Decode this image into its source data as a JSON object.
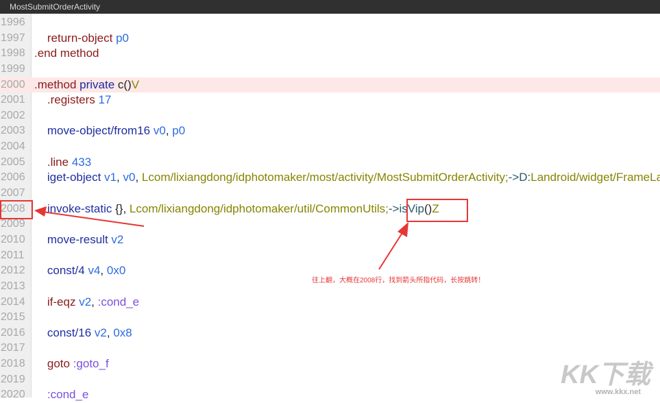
{
  "window": {
    "title": "MostSubmitOrderActivity"
  },
  "code_lines": [
    {
      "n": "1996",
      "tokens": []
    },
    {
      "n": "1997",
      "tokens": [
        [
          "    return-object ",
          "t-ret"
        ],
        [
          "p0",
          "t-reg"
        ]
      ]
    },
    {
      "n": "1998",
      "tokens": [
        [
          ".end method",
          "t-dir"
        ]
      ]
    },
    {
      "n": "1999",
      "tokens": []
    },
    {
      "n": "2000",
      "highlight": true,
      "tokens": [
        [
          ".method ",
          "t-dir"
        ],
        [
          "private ",
          "t-kw"
        ],
        [
          "c()",
          "t-plain"
        ],
        [
          "V",
          "t-type"
        ]
      ]
    },
    {
      "n": "2001",
      "tokens": [
        [
          "    .registers ",
          "t-dir"
        ],
        [
          "17",
          "t-reg"
        ]
      ]
    },
    {
      "n": "2002",
      "tokens": []
    },
    {
      "n": "2003",
      "tokens": [
        [
          "    move-object/from16 ",
          "t-op"
        ],
        [
          "v0",
          "t-reg"
        ],
        [
          ", ",
          "t-plain"
        ],
        [
          "p0",
          "t-reg"
        ]
      ]
    },
    {
      "n": "2004",
      "tokens": []
    },
    {
      "n": "2005",
      "tokens": [
        [
          "    .line ",
          "t-dir"
        ],
        [
          "433",
          "t-reg"
        ]
      ]
    },
    {
      "n": "2006",
      "tokens": [
        [
          "    iget-object ",
          "t-op"
        ],
        [
          "v1",
          "t-reg"
        ],
        [
          ", ",
          "t-plain"
        ],
        [
          "v0",
          "t-reg"
        ],
        [
          ", ",
          "t-plain"
        ],
        [
          "Lcom/lixiangdong/idphotomaker/most/activity/MostSubmitOrderActivity;",
          "t-type"
        ],
        [
          "->D:",
          "t-meth"
        ],
        [
          "Landroid/widget/FrameLayout;",
          "t-type"
        ]
      ]
    },
    {
      "n": "2007",
      "tokens": []
    },
    {
      "n": "2008",
      "tokens": [
        [
          "    invoke-static ",
          "t-op"
        ],
        [
          "{}, ",
          "t-plain"
        ],
        [
          "Lcom/lixiangdong/idphotomaker/util/CommonUtils;",
          "t-type"
        ],
        [
          "->isVip",
          "t-meth"
        ],
        [
          "()",
          "t-plain"
        ],
        [
          "Z",
          "t-type"
        ]
      ]
    },
    {
      "n": "2009",
      "tokens": []
    },
    {
      "n": "2010",
      "tokens": [
        [
          "    move-result ",
          "t-op"
        ],
        [
          "v2",
          "t-reg"
        ]
      ]
    },
    {
      "n": "2011",
      "tokens": []
    },
    {
      "n": "2012",
      "tokens": [
        [
          "    const/4 ",
          "t-op"
        ],
        [
          "v4",
          "t-reg"
        ],
        [
          ", ",
          "t-plain"
        ],
        [
          "0x0",
          "t-reg"
        ]
      ]
    },
    {
      "n": "2013",
      "tokens": []
    },
    {
      "n": "2014",
      "tokens": [
        [
          "    if-eqz ",
          "t-ret"
        ],
        [
          "v2",
          "t-reg"
        ],
        [
          ", ",
          "t-plain"
        ],
        [
          ":cond_e",
          "t-lbl"
        ]
      ]
    },
    {
      "n": "2015",
      "tokens": []
    },
    {
      "n": "2016",
      "tokens": [
        [
          "    const/16 ",
          "t-op"
        ],
        [
          "v2",
          "t-reg"
        ],
        [
          ", ",
          "t-plain"
        ],
        [
          "0x8",
          "t-reg"
        ]
      ]
    },
    {
      "n": "2017",
      "tokens": []
    },
    {
      "n": "2018",
      "tokens": [
        [
          "    goto ",
          "t-ret"
        ],
        [
          ":goto_f",
          "t-lbl"
        ]
      ]
    },
    {
      "n": "2019",
      "tokens": []
    },
    {
      "n": "2020",
      "tokens": [
        [
          "    :cond_e",
          "t-lbl"
        ]
      ]
    }
  ],
  "annotation": {
    "note": "往上翻，大概在2008行，找到箭头所指代码，长按跳转！",
    "color": "#e83535"
  },
  "watermark": {
    "logo": "KK下载",
    "url": "www.kkx.net"
  }
}
